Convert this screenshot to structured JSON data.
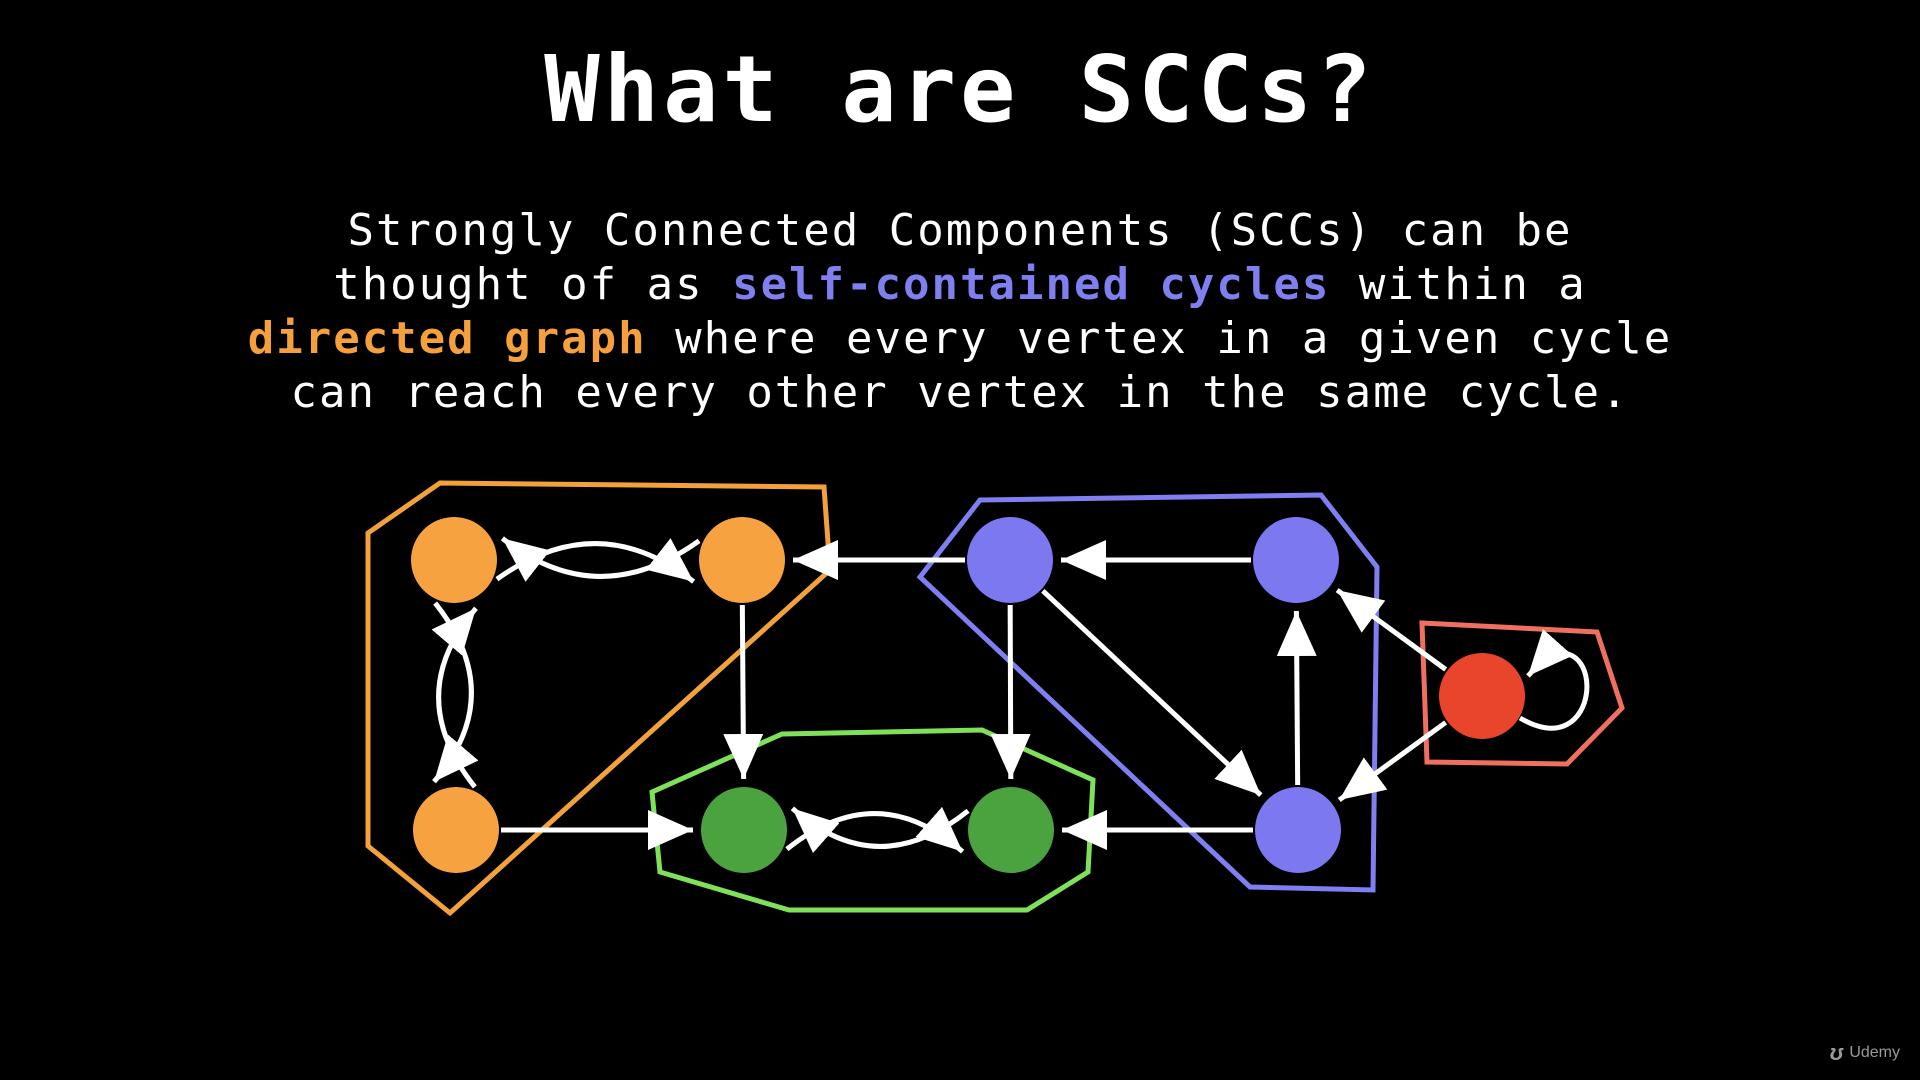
{
  "slide": {
    "title": "What are SCCs?",
    "description": {
      "line1": "Strongly Connected Components (SCCs) can be",
      "line2_pre": "thought of as ",
      "line2_highlight": "self-contained cycles",
      "line2_post": " within a",
      "line3_highlight": "directed graph",
      "line3_post": " where every vertex in a given cycle",
      "line4": "can reach every other vertex in the same cycle."
    }
  },
  "colors": {
    "background": "#000000",
    "text": "#ffffff",
    "highlight_blue": "#7f7ff0",
    "highlight_orange": "#f5a03c",
    "orange_node": "#f7a241",
    "green_node": "#4ba33f",
    "blue_node": "#7b78f0",
    "red_node": "#e8452c",
    "orange_outline": "#f3a13c",
    "green_outline": "#7fe05a",
    "blue_outline": "#7f7ff2",
    "red_outline": "#f07060",
    "edge": "#ffffff"
  },
  "graph": {
    "components": [
      "orange",
      "green",
      "blue",
      "red"
    ],
    "nodes": [
      {
        "id": "o1",
        "component": "orange"
      },
      {
        "id": "o2",
        "component": "orange"
      },
      {
        "id": "o3",
        "component": "orange"
      },
      {
        "id": "g1",
        "component": "green"
      },
      {
        "id": "g2",
        "component": "green"
      },
      {
        "id": "b1",
        "component": "blue"
      },
      {
        "id": "b2",
        "component": "blue"
      },
      {
        "id": "b3",
        "component": "blue"
      },
      {
        "id": "r1",
        "component": "red"
      }
    ],
    "edges": [
      {
        "from": "o1",
        "to": "o2"
      },
      {
        "from": "o2",
        "to": "o1"
      },
      {
        "from": "o1",
        "to": "o3"
      },
      {
        "from": "o3",
        "to": "o1"
      },
      {
        "from": "o2",
        "to": "g1"
      },
      {
        "from": "o3",
        "to": "g1"
      },
      {
        "from": "g1",
        "to": "g2"
      },
      {
        "from": "g2",
        "to": "g1"
      },
      {
        "from": "b1",
        "to": "o2"
      },
      {
        "from": "b2",
        "to": "b1"
      },
      {
        "from": "b1",
        "to": "g2"
      },
      {
        "from": "b1",
        "to": "b3"
      },
      {
        "from": "b3",
        "to": "b2"
      },
      {
        "from": "b3",
        "to": "g2"
      },
      {
        "from": "r1",
        "to": "b2"
      },
      {
        "from": "r1",
        "to": "b3"
      },
      {
        "from": "r1",
        "to": "r1"
      }
    ]
  },
  "watermark": {
    "icon": "udemy-logo-icon",
    "text": "Udemy"
  }
}
